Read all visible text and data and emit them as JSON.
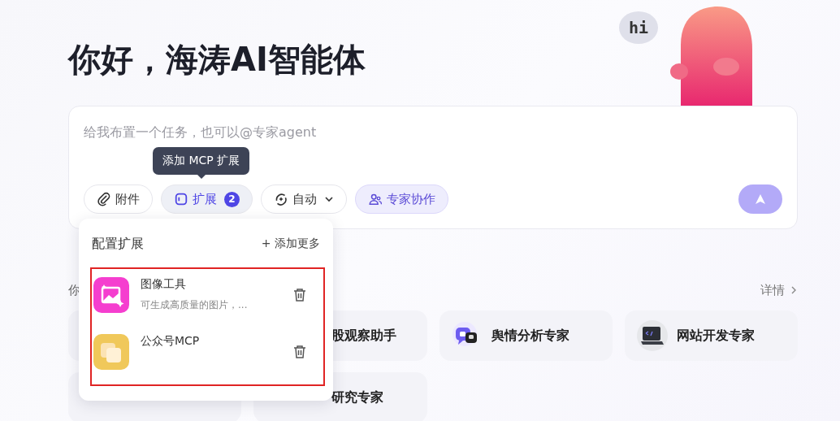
{
  "greeting": "你好，海涛AI智能体",
  "mascot": {
    "bubble": "hi"
  },
  "composer": {
    "placeholder": "给我布置一个任务，也可以@专家agent",
    "tooltip": "添加 MCP 扩展",
    "tools": [
      {
        "kind": "attach",
        "label": "附件",
        "open": false,
        "on": false
      },
      {
        "kind": "extension",
        "label": "扩展",
        "badge": "2",
        "open": true,
        "on": false
      },
      {
        "kind": "auto",
        "label": "自动",
        "open": false,
        "on": false
      },
      {
        "kind": "experts",
        "label": "专家协作",
        "open": false,
        "on": true
      }
    ]
  },
  "extension_popup": {
    "title": "配置扩展",
    "add_more": "+ 添加更多",
    "highlighted": true,
    "items": [
      {
        "kind": "image",
        "name": "图像工具",
        "description": "可生成高质量的图片，..."
      },
      {
        "kind": "copy",
        "name": "公众号MCP"
      }
    ]
  },
  "section": {
    "title": "你",
    "more": "详情"
  },
  "agents": [
    {
      "kind": "covered"
    },
    {
      "kind": "partial",
      "label": "股观察助手"
    },
    {
      "kind": "thumbs",
      "label": "舆情分析专家"
    },
    {
      "kind": "laptop",
      "label": "网站开发专家"
    },
    {
      "kind": "covered"
    },
    {
      "kind": "partial",
      "label": "研究专家"
    }
  ]
}
